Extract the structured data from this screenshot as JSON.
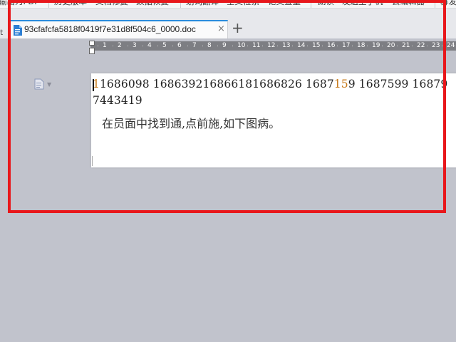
{
  "toolbar": {
    "items": [
      "输出为PDF",
      "历史版本",
      "文档修复",
      "数据恢复",
      "划词翻译",
      "全文检索",
      "论文查重",
      "朗读",
      "发送至手机",
      "云编辑器",
      "群发"
    ]
  },
  "tabs": {
    "active_label": "93cfafcfa5818f0419f7e31d8f504c6_0000.doc",
    "close_symbol": "×",
    "new_tab_symbol": "+",
    "left_stub": "t"
  },
  "ruler": {
    "numbers": [
      "1",
      "2",
      "3",
      "4",
      "5",
      "6",
      "7",
      "8",
      "9",
      "10",
      "11",
      "12",
      "13",
      "14",
      "15",
      "16",
      "17",
      "18",
      "19",
      "20",
      "21",
      "22",
      "23",
      "24"
    ]
  },
  "document": {
    "line1": [
      "1",
      "1686098 ",
      "1686392",
      "1686618",
      "1686826 ",
      "1687",
      "1",
      "5",
      "9 ",
      "1687599 ",
      "16879"
    ],
    "line1_text": "11686098  16863921686618168682 6  1687159  1687599  16879",
    "line2_text": "7443419",
    "line3_text": "在员面中找到通,点前施,如下图病。"
  },
  "colors": {
    "highlight": "#e8171b",
    "tab_accent": "#2a8cdd",
    "workspace": "#c1c3cc",
    "number_orange": "#c77a1a"
  },
  "icons": {
    "tab_icon": "doc-file-icon",
    "side_icon": "doc-outline-icon",
    "side_dropdown": "chevron-down-icon"
  }
}
